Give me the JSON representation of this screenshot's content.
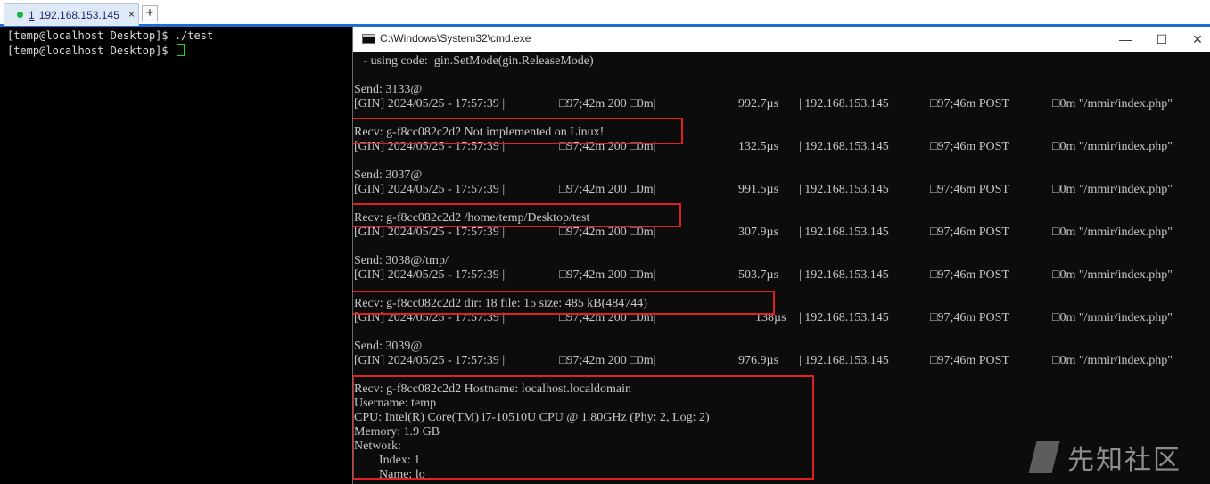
{
  "session_tab": {
    "status_color": "#19b53b",
    "number": "1",
    "host": "192.168.153.145",
    "close": "×",
    "add": "+"
  },
  "terminal": {
    "lines": [
      "[temp@localhost Desktop]$ ./test",
      "[temp@localhost Desktop]$ "
    ],
    "cursor_color": "#1fd81f"
  },
  "cmd": {
    "title": "C:\\Windows\\System32\\cmd.exe",
    "buttons": {
      "minimize": "—",
      "maximize": "☐",
      "close": "✕"
    },
    "mode_line": " - using code:  gin.SetMode(gin.ReleaseMode)",
    "gin_prefix": "[GIN] 2024/05/25 - 17:57:39 |",
    "status": "□97;42m 200 □0m|",
    "ip": "| 192.168.153.145 |",
    "method": "□97;46m POST",
    "path": "□0m \"/mmir/index.php\"",
    "entries": [
      {
        "send": "Send: 3133@",
        "gin_latency": "992.7µs",
        "recv": "Recv: g-f8cc082c2d2 Not implemented on Linux!",
        "recv_latency": "132.5µs"
      },
      {
        "send": "Send: 3037@",
        "gin_latency": "991.5µs",
        "recv": "Recv: g-f8cc082c2d2 /home/temp/Desktop/test",
        "recv_latency": "307.9µs"
      },
      {
        "send": "Send: 3038@/tmp/",
        "gin_latency": "503.7µs",
        "recv": "Recv: g-f8cc082c2d2 dir: 18 file: 15 size: 485 kB(484744)",
        "recv_latency": "138µs"
      },
      {
        "send": "Send: 3039@",
        "gin_latency": "976.9µs"
      }
    ],
    "final_recv": [
      "Recv: g-f8cc082c2d2 Hostname: localhost.localdomain",
      "Username: temp",
      "CPU: Intel(R) Core(TM) i7-10510U CPU @ 1.80GHz (Phy: 2, Log: 2)",
      "Memory: 1.9 GB",
      "Network:",
      "        Index: 1",
      "        Name: lo"
    ],
    "highlight_color": "#e02020"
  },
  "watermark": {
    "text": "先知社区"
  }
}
